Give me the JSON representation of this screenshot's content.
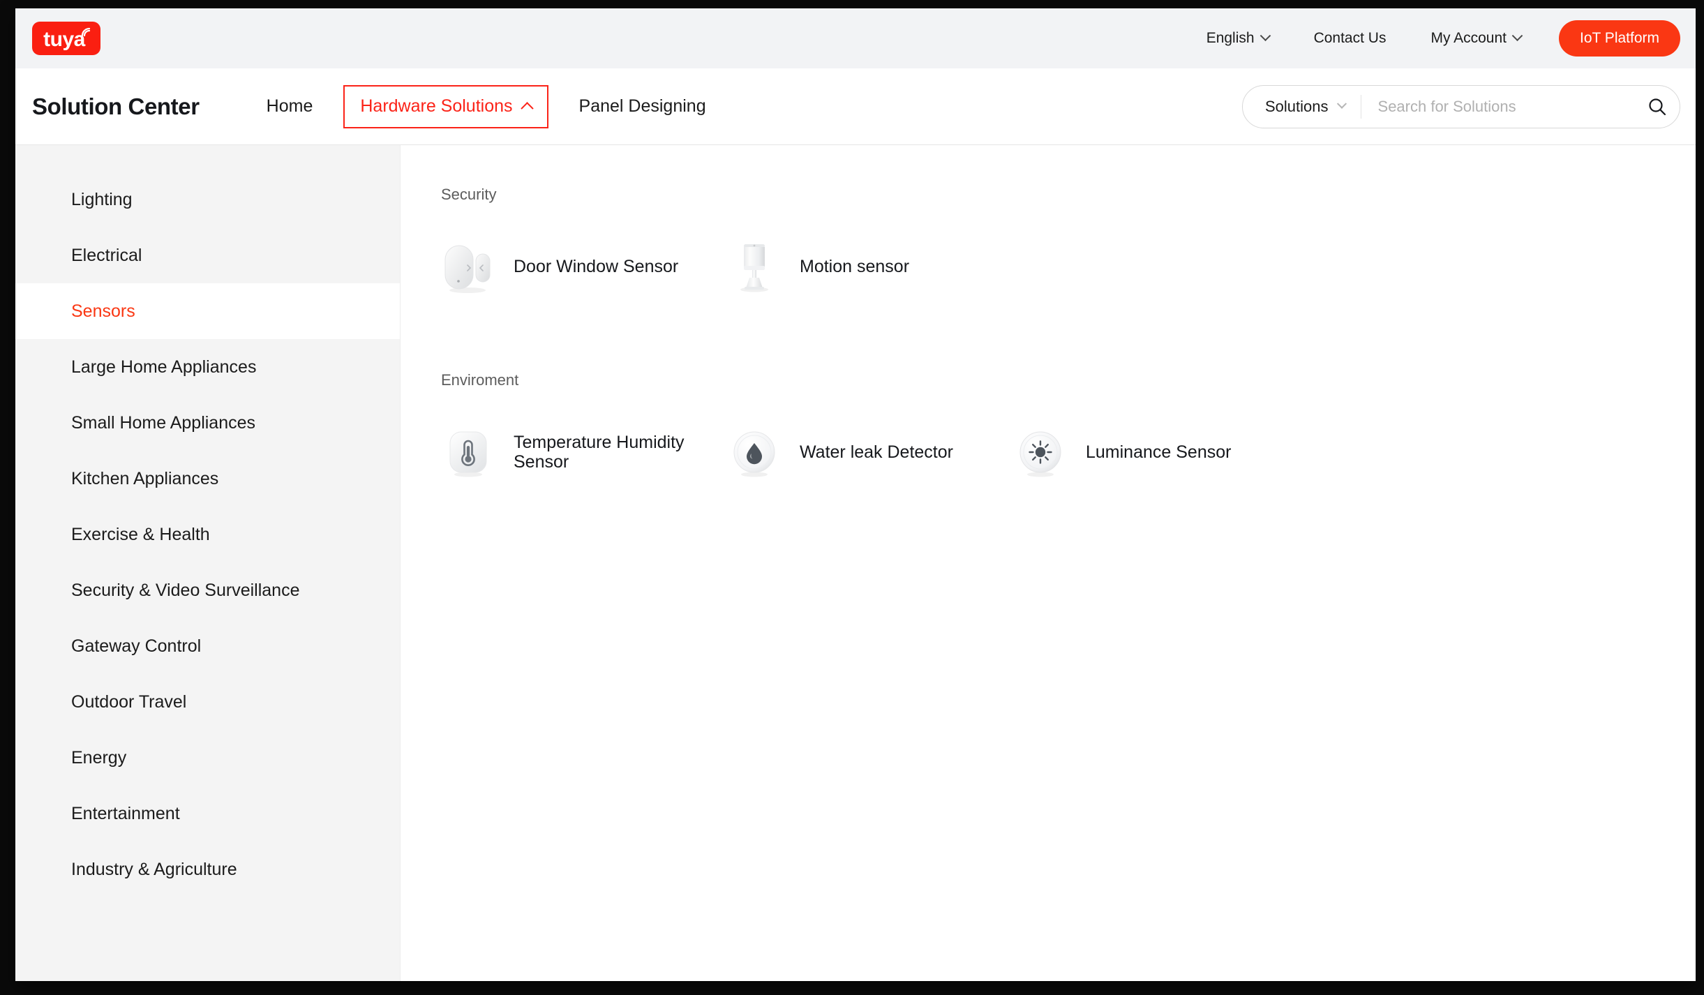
{
  "utility_bar": {
    "logo_text": "tuya",
    "logo_icon": "wifi-arc-icon",
    "language": "English",
    "contact": "Contact Us",
    "account": "My Account",
    "iot_button": "IoT Platform",
    "brand_color": "#fa1f11",
    "button_color": "#fa3713"
  },
  "nav": {
    "brand_title": "Solution Center",
    "links": [
      {
        "label": "Home",
        "active": false
      },
      {
        "label": "Hardware Solutions",
        "active": true
      },
      {
        "label": "Panel Designing",
        "active": false
      }
    ],
    "active_color": "#fb2318"
  },
  "search": {
    "scope_label": "Solutions",
    "placeholder": "Search for Solutions",
    "value": "",
    "icon": "search-icon"
  },
  "sidebar": {
    "items": [
      {
        "label": "Lighting",
        "active": false
      },
      {
        "label": "Electrical",
        "active": false
      },
      {
        "label": "Sensors",
        "active": true
      },
      {
        "label": "Large Home Appliances",
        "active": false
      },
      {
        "label": "Small Home Appliances",
        "active": false
      },
      {
        "label": "Kitchen Appliances",
        "active": false
      },
      {
        "label": "Exercise & Health",
        "active": false
      },
      {
        "label": "Security & Video Surveillance",
        "active": false
      },
      {
        "label": "Gateway Control",
        "active": false
      },
      {
        "label": "Outdoor Travel",
        "active": false
      },
      {
        "label": "Energy",
        "active": false
      },
      {
        "label": "Entertainment",
        "active": false
      },
      {
        "label": "Industry & Agriculture",
        "active": false
      }
    ],
    "active_color": "#fa3713"
  },
  "content": {
    "sections": [
      {
        "title": "Security",
        "items": [
          {
            "label": "Door Window Sensor",
            "icon": "door-window-sensor-icon"
          },
          {
            "label": "Motion sensor",
            "icon": "motion-sensor-icon"
          }
        ]
      },
      {
        "title": "Enviroment",
        "items": [
          {
            "label": "Temperature Humidity Sensor",
            "icon": "thermometer-icon"
          },
          {
            "label": "Water leak Detector",
            "icon": "water-drop-icon"
          },
          {
            "label": "Luminance Sensor",
            "icon": "brightness-sun-icon"
          }
        ]
      }
    ]
  }
}
